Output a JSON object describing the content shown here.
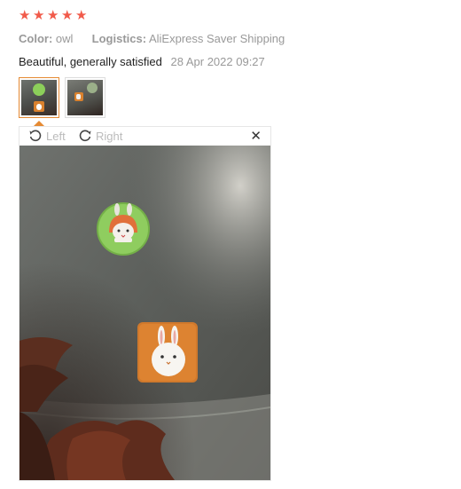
{
  "rating": {
    "stars": 5,
    "max": 5,
    "star_color": "#f15a4a"
  },
  "attributes": {
    "color_key": "Color:",
    "color_value": "owl",
    "logistics_key": "Logistics:",
    "logistics_value": "AliExpress Saver Shipping"
  },
  "review": {
    "text": "Beautiful, generally satisfied",
    "date": "28 Apr 2022 09:27"
  },
  "thumbnails": [
    {
      "name": "photo-1",
      "active": true
    },
    {
      "name": "photo-2",
      "active": false
    }
  ],
  "viewer": {
    "rotate_left_label": "Left",
    "rotate_right_label": "Right",
    "close_glyph": "✕"
  },
  "colors": {
    "accent": "#e58a33",
    "muted": "#999999"
  }
}
